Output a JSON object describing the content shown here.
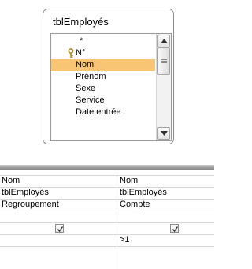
{
  "table": {
    "title": "tblEmployés",
    "fields": [
      "*",
      "N°",
      "Nom",
      "Prénom",
      "Sexe",
      "Service",
      "Date entrée"
    ],
    "selected": "Nom",
    "primary_key": "N°"
  },
  "grid": {
    "rows": [
      {
        "name": "field",
        "values": [
          "Nom",
          "Nom"
        ]
      },
      {
        "name": "table",
        "values": [
          "tblEmployés",
          "tblEmployés"
        ]
      },
      {
        "name": "total",
        "values": [
          "Regroupement",
          "Compte"
        ]
      },
      {
        "name": "sort",
        "values": [
          "",
          ""
        ]
      },
      {
        "name": "show",
        "checked": [
          true,
          true
        ]
      },
      {
        "name": "criteria",
        "values": [
          "",
          ">1"
        ]
      }
    ]
  },
  "colors": {
    "selected_field": "#f7c573",
    "splitter": "#9d9d9d"
  }
}
